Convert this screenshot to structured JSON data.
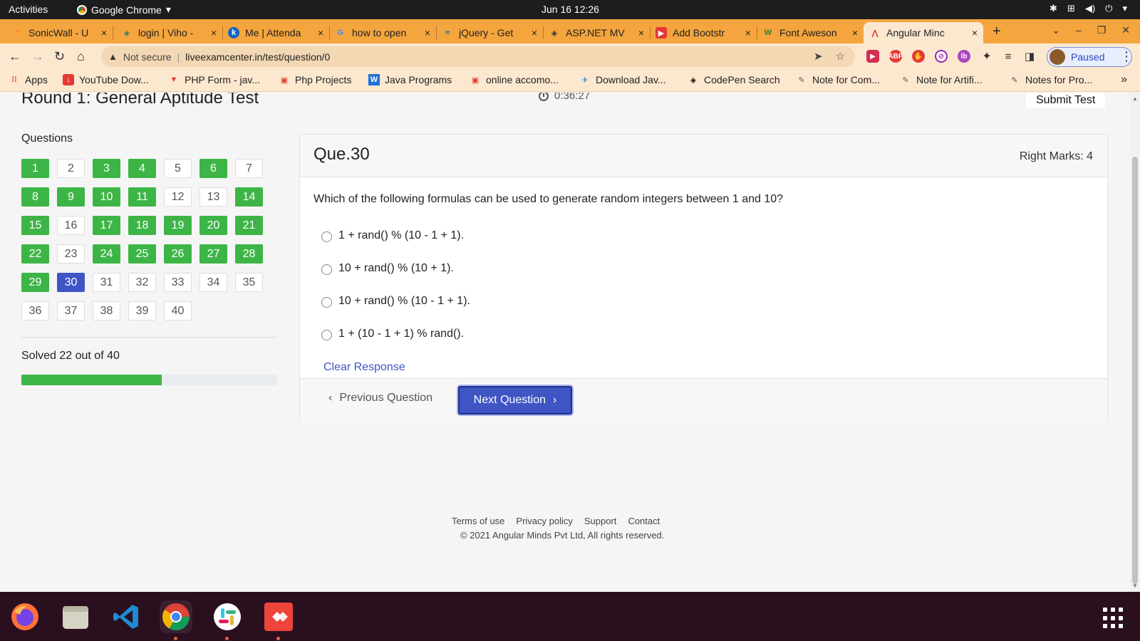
{
  "system": {
    "activities": "Activities",
    "app_name": "Google Chrome",
    "app_caret": "▾",
    "clock": "Jun 16  12:26"
  },
  "tabs": [
    {
      "title": "SonicWall - U",
      "icon": "sonicwall-icon"
    },
    {
      "title": "login | Viho -",
      "icon": "viho-icon"
    },
    {
      "title": "Me | Attenda",
      "icon": "k-icon"
    },
    {
      "title": "how to open",
      "icon": "google-icon"
    },
    {
      "title": "jQuery - Get",
      "icon": "jquery-icon"
    },
    {
      "title": "ASP.NET MV",
      "icon": "aspnet-icon"
    },
    {
      "title": "Add Bootstr",
      "icon": "youtube-icon"
    },
    {
      "title": "Font Aweson",
      "icon": "w-icon"
    },
    {
      "title": "Angular Minc",
      "icon": "angular-minds-icon",
      "active": true
    }
  ],
  "tab_close": "×",
  "new_tab": "+",
  "address": {
    "warning": "▲",
    "not_secure": "Not secure",
    "url": "liveexamcenter.in/test/question/0"
  },
  "profile_label": "Paused",
  "bookmarks": [
    {
      "label": "Apps",
      "icon": "apps-icon"
    },
    {
      "label": "YouTube Dow...",
      "icon": "download-icon"
    },
    {
      "label": "PHP Form - jav...",
      "icon": "php-icon"
    },
    {
      "label": "Php Projects",
      "icon": "projects-icon"
    },
    {
      "label": "Java Programs",
      "icon": "w-icon"
    },
    {
      "label": "online accomo...",
      "icon": "projects-icon"
    },
    {
      "label": "Download Jav...",
      "icon": "bird-icon"
    },
    {
      "label": "CodePen Search",
      "icon": "codepen-icon"
    },
    {
      "label": "Note for Com...",
      "icon": "note-icon"
    },
    {
      "label": "Note for Artifi...",
      "icon": "note-icon"
    },
    {
      "label": "Notes for Pro...",
      "icon": "note-icon"
    }
  ],
  "bookmarks_more": "»",
  "page": {
    "title": "Round 1: General Aptitude Test",
    "timer": "0:36:27",
    "submit": "Submit Test",
    "questions_label": "Questions",
    "solved_text": "Solved 22 out of 40",
    "progress_fraction": 0.55,
    "current_question": 30,
    "questions": [
      {
        "n": "1",
        "s": "solved"
      },
      {
        "n": "2",
        "s": "unsolved"
      },
      {
        "n": "3",
        "s": "solved"
      },
      {
        "n": "4",
        "s": "solved"
      },
      {
        "n": "5",
        "s": "unsolved"
      },
      {
        "n": "6",
        "s": "solved"
      },
      {
        "n": "7",
        "s": "unsolved"
      },
      {
        "n": "8",
        "s": "solved"
      },
      {
        "n": "9",
        "s": "solved"
      },
      {
        "n": "10",
        "s": "solved"
      },
      {
        "n": "11",
        "s": "solved"
      },
      {
        "n": "12",
        "s": "unsolved"
      },
      {
        "n": "13",
        "s": "unsolved"
      },
      {
        "n": "14",
        "s": "solved"
      },
      {
        "n": "15",
        "s": "solved"
      },
      {
        "n": "16",
        "s": "unsolved"
      },
      {
        "n": "17",
        "s": "solved"
      },
      {
        "n": "18",
        "s": "solved"
      },
      {
        "n": "19",
        "s": "solved"
      },
      {
        "n": "20",
        "s": "solved"
      },
      {
        "n": "21",
        "s": "solved"
      },
      {
        "n": "22",
        "s": "solved"
      },
      {
        "n": "23",
        "s": "unsolved"
      },
      {
        "n": "24",
        "s": "solved"
      },
      {
        "n": "25",
        "s": "solved"
      },
      {
        "n": "26",
        "s": "solved"
      },
      {
        "n": "27",
        "s": "solved"
      },
      {
        "n": "28",
        "s": "solved"
      },
      {
        "n": "29",
        "s": "solved"
      },
      {
        "n": "30",
        "s": "current"
      },
      {
        "n": "31",
        "s": "unsolved"
      },
      {
        "n": "32",
        "s": "unsolved"
      },
      {
        "n": "33",
        "s": "unsolved"
      },
      {
        "n": "34",
        "s": "unsolved"
      },
      {
        "n": "35",
        "s": "unsolved"
      },
      {
        "n": "36",
        "s": "unsolved"
      },
      {
        "n": "37",
        "s": "unsolved"
      },
      {
        "n": "38",
        "s": "unsolved"
      },
      {
        "n": "39",
        "s": "unsolved"
      },
      {
        "n": "40",
        "s": "unsolved"
      }
    ],
    "question_number": "Que.30",
    "right_marks": "Right Marks: 4",
    "question_text": "Which of the following formulas can be used to generate random integers between 1 and 10?",
    "options": [
      "1 + rand() % (10 - 1 + 1).",
      "10 + rand() % (10 + 1).",
      "10 + rand() % (10 - 1 + 1).",
      "1 + (10 - 1 + 1) % rand()."
    ],
    "clear_response": "Clear Response",
    "prev": "Previous Question",
    "next": "Next Question",
    "footer_links": [
      "Terms of use",
      "Privacy policy",
      "Support",
      "Contact"
    ],
    "copyright": "© 2021 Angular Minds Pvt Ltd, All rights reserved."
  },
  "colors": {
    "solved": "#3db546",
    "current": "#3f55c4",
    "tabstrip": "#f4a53d",
    "toolbar": "#fce8cf"
  },
  "dock": [
    {
      "name": "firefox-icon",
      "running": false
    },
    {
      "name": "files-icon",
      "running": false
    },
    {
      "name": "vscode-icon",
      "running": false
    },
    {
      "name": "chrome-icon",
      "running": true
    },
    {
      "name": "slack-icon",
      "running": true
    },
    {
      "name": "anydesk-icon",
      "running": true
    }
  ]
}
